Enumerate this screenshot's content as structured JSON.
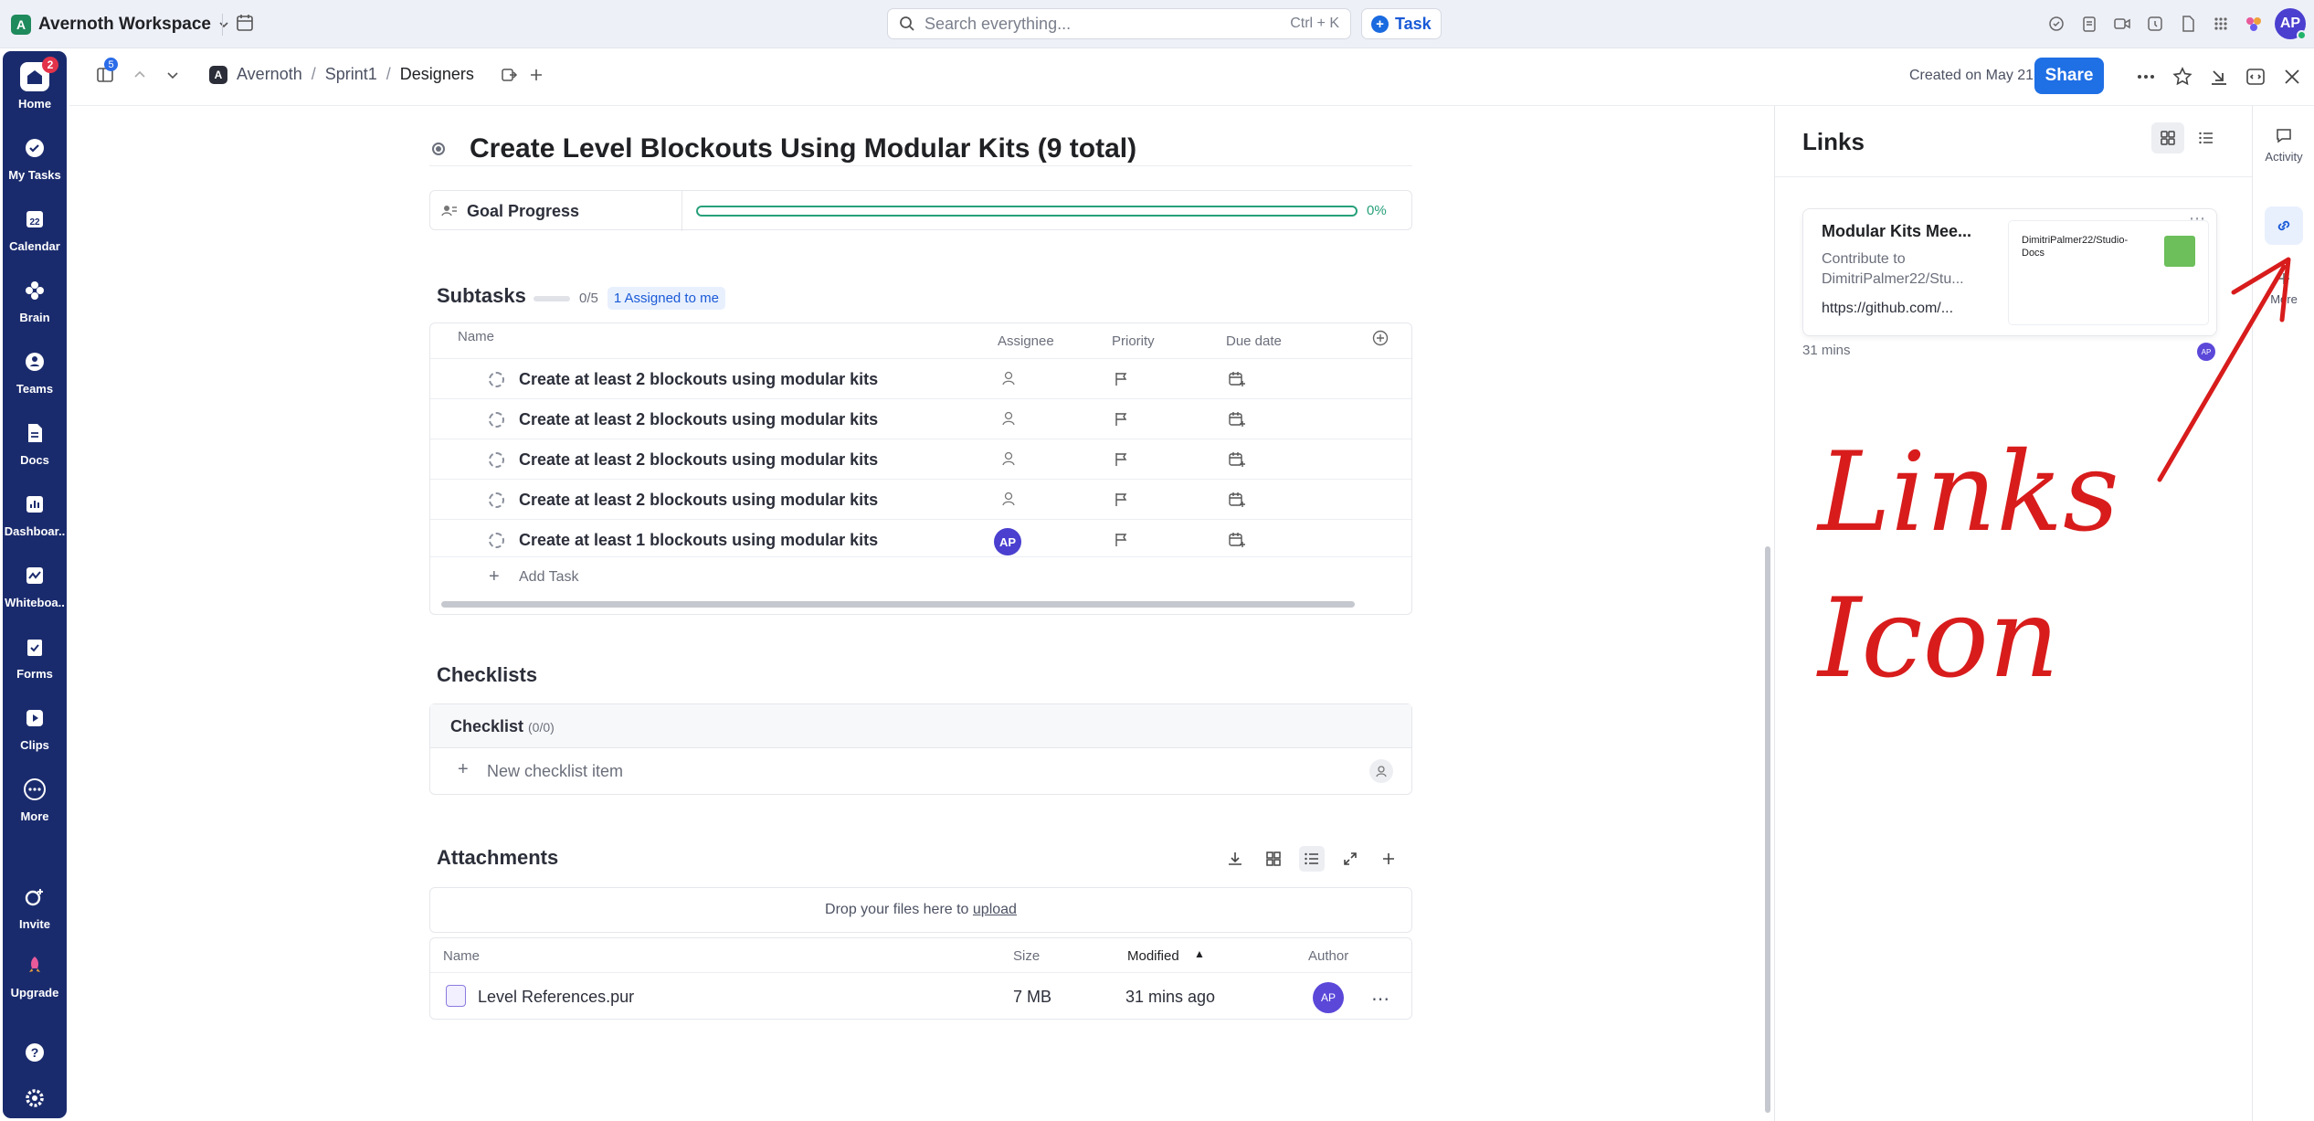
{
  "workspace": {
    "name": "Avernoth Workspace",
    "initial": "A"
  },
  "search": {
    "placeholder": "Search everything...",
    "shortcut": "Ctrl + K"
  },
  "task_button": "Task",
  "user": {
    "initials": "AP"
  },
  "rail": {
    "home_badge": "2",
    "items": [
      "Home",
      "My Tasks",
      "Calendar",
      "Brain",
      "Teams",
      "Docs",
      "Dashboar..",
      "Whiteboa..",
      "Forms",
      "Clips",
      "More",
      "Invite",
      "Upgrade"
    ],
    "calendar_day": "22"
  },
  "header": {
    "tab_badge": "5",
    "breadcrumb": {
      "space_initial": "A",
      "items": [
        "Avernoth",
        "Sprint1",
        "Designers"
      ],
      "separator": "/"
    },
    "created": "Created on May 21",
    "share": "Share"
  },
  "task": {
    "title": "Create Level Blockouts Using Modular Kits (9 total)",
    "goal_label": "Goal Progress",
    "goal_progress": 0,
    "goal_pct_text": "0%"
  },
  "subtasks": {
    "title": "Subtasks",
    "count": "0/5",
    "assigned_chip": "1 Assigned to me",
    "columns": {
      "name": "Name",
      "assignee": "Assignee",
      "priority": "Priority",
      "due": "Due date"
    },
    "rows": [
      {
        "name": "Create at least 2 blockouts using modular kits",
        "assignee": ""
      },
      {
        "name": "Create at least 2 blockouts using modular kits",
        "assignee": ""
      },
      {
        "name": "Create at least 2 blockouts using modular kits",
        "assignee": ""
      },
      {
        "name": "Create at least 2 blockouts using modular kits",
        "assignee": ""
      },
      {
        "name": "Create at least 1 blockouts using modular kits",
        "assignee": "AP"
      }
    ],
    "add_task": "Add Task"
  },
  "checklists": {
    "title": "Checklists",
    "checklist_name": "Checklist",
    "checklist_count": "(0/0)",
    "new_item_placeholder": "New checklist item"
  },
  "attachments": {
    "title": "Attachments",
    "drop_text": "Drop your files here to",
    "drop_link": "upload",
    "columns": {
      "name": "Name",
      "size": "Size",
      "modified": "Modified",
      "author": "Author"
    },
    "files": [
      {
        "name": "Level References.pur",
        "size": "7 MB",
        "modified": "31 mins ago",
        "author": "AP"
      }
    ]
  },
  "links_panel": {
    "title": "Links",
    "card": {
      "title": "Modular Kits Mee...",
      "description": "Contribute to DimitriPalmer22/Stu...",
      "url": "https://github.com/...",
      "thumb_text": "DimitriPalmer22/Studio-Docs"
    },
    "time": "31 mins",
    "author": "AP"
  },
  "right_sidebar": {
    "activity": "Activity",
    "more": "More"
  },
  "annotation": {
    "line1": "Links",
    "line2": "Icon",
    "color": "#d81c1c"
  }
}
